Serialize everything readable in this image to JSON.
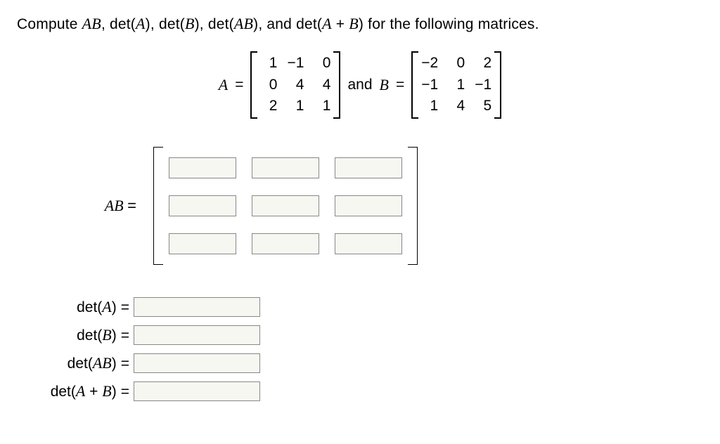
{
  "prompt": {
    "leadText": "Compute ",
    "items_text": [
      "AB",
      "det(A)",
      "det(B)",
      "det(AB)",
      "det(A + B)"
    ],
    "trailText": " for the following matrices."
  },
  "given": {
    "A_label": "A",
    "B_label": "B",
    "equals": "=",
    "and": "and",
    "A": [
      [
        "1",
        "−1",
        "0"
      ],
      [
        "0",
        "4",
        "4"
      ],
      [
        "2",
        "1",
        "1"
      ]
    ],
    "B": [
      [
        "−2",
        "0",
        "2"
      ],
      [
        "−1",
        "1",
        "−1"
      ],
      [
        "1",
        "4",
        "5"
      ]
    ]
  },
  "answers": {
    "AB_label": "AB",
    "AB": [
      [
        "",
        "",
        ""
      ],
      [
        "",
        "",
        ""
      ],
      [
        "",
        "",
        ""
      ]
    ],
    "scalars": [
      {
        "label_html": "det(<i>A</i>)",
        "value": ""
      },
      {
        "label_html": "det(<i>B</i>)",
        "value": ""
      },
      {
        "label_html": "det(<i>AB</i>)",
        "value": ""
      },
      {
        "label_html": "det(<i>A</i> + <i>B</i>)",
        "value": ""
      }
    ]
  }
}
